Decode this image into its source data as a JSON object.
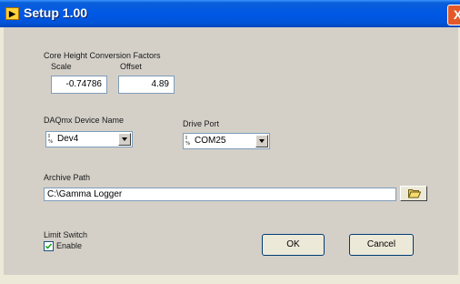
{
  "window": {
    "title": "Setup 1.00",
    "close_glyph": "X"
  },
  "core_height": {
    "group_label": "Core Height Conversion Factors",
    "scale_label": "Scale",
    "scale_value": "-0.74786",
    "offset_label": "Offset",
    "offset_value": "4.89"
  },
  "daqmx": {
    "label": "DAQmx Device Name",
    "value": "Dev4"
  },
  "drive_port": {
    "label": "Drive Port",
    "value": "COM25"
  },
  "archive": {
    "label": "Archive Path",
    "value": "C:\\Gamma Logger"
  },
  "limit_switch": {
    "label": "Limit Switch",
    "checkbox_label": "Enable",
    "checked": true
  },
  "buttons": {
    "ok": "OK",
    "cancel": "Cancel"
  },
  "icons": {
    "app": "labview-icon",
    "close": "close-icon",
    "combo": "io-name-icon",
    "browse": "folder-open-icon",
    "check": "checkmark-icon"
  },
  "colors": {
    "title_bar": "#0054d8",
    "panel": "#d4d0c8",
    "close": "#e35a2a"
  }
}
